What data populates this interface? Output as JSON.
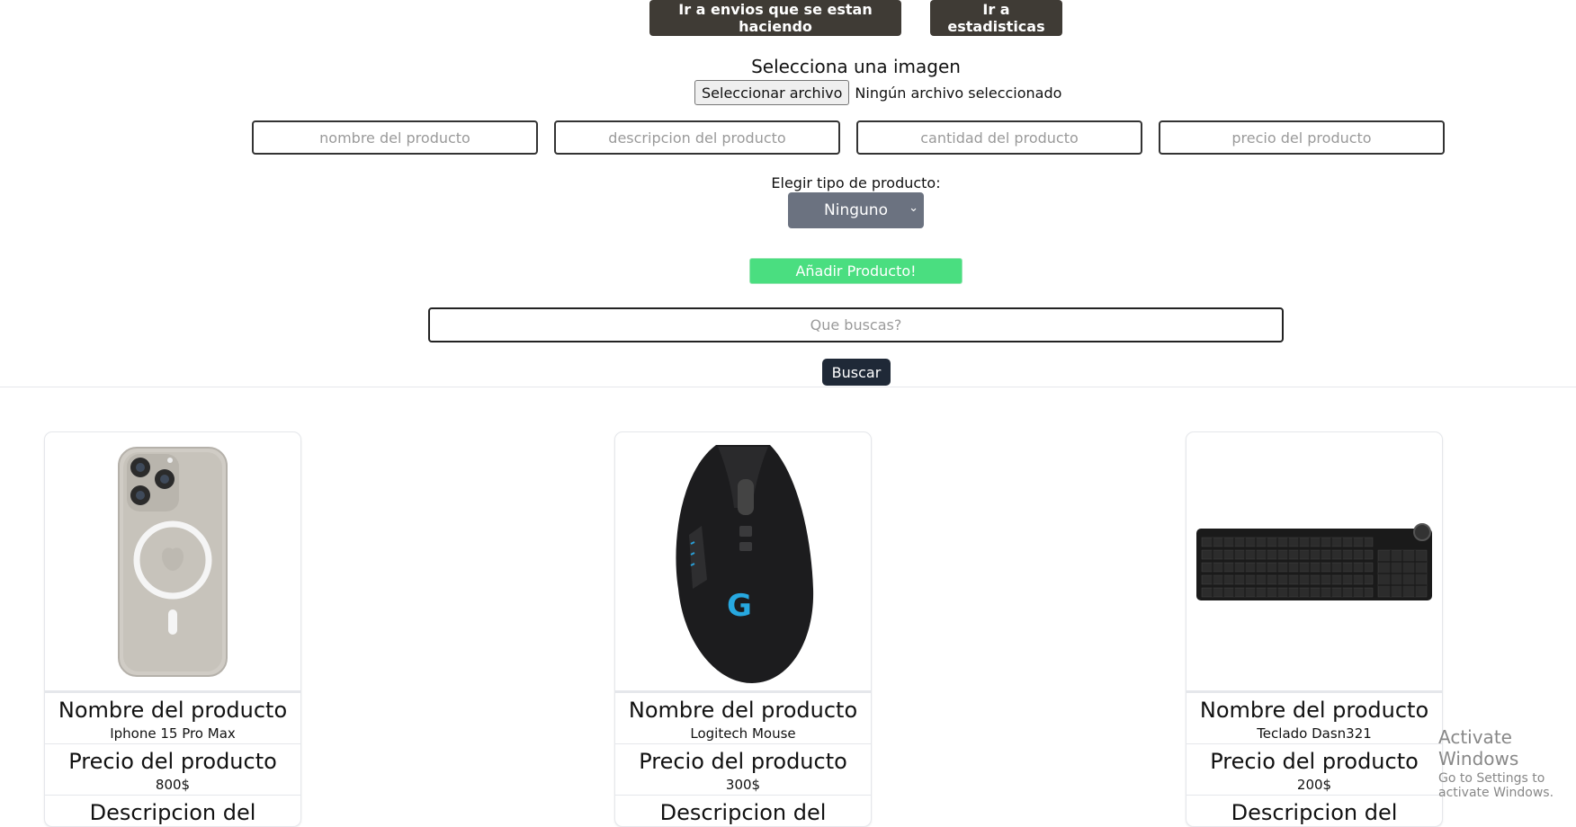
{
  "header": {
    "btn_envios": "Ir a envios que se estan haciendo",
    "btn_estadisticas": "Ir a estadisticas"
  },
  "upload": {
    "label": "Selecciona una imagen",
    "button": "Seleccionar archivo",
    "status": "Ningún archivo seleccionado"
  },
  "form": {
    "nombre_placeholder": "nombre del producto",
    "descripcion_placeholder": "descripcion del producto",
    "cantidad_placeholder": "cantidad del producto",
    "precio_placeholder": "precio del producto",
    "tipo_label": "Elegir tipo de producto:",
    "tipo_selected": "Ninguno",
    "add_button": "Añadir Producto!"
  },
  "search": {
    "placeholder": "Que buscas?",
    "button": "Buscar"
  },
  "products": [
    {
      "name_title": "Nombre del producto",
      "name": "Iphone 15 Pro Max",
      "price_title": "Precio del producto",
      "price": "800$",
      "desc_title": "Descripcion del producto"
    },
    {
      "name_title": "Nombre del producto",
      "name": "Logitech Mouse",
      "price_title": "Precio del producto",
      "price": "300$",
      "desc_title": "Descripcion del producto"
    },
    {
      "name_title": "Nombre del producto",
      "name": "Teclado Dasn321",
      "price_title": "Precio del producto",
      "price": "200$",
      "desc_title": "Descripcion del producto"
    }
  ],
  "watermark": {
    "line1": "Activate Windows",
    "line2": "Go to Settings to activate Windows."
  }
}
